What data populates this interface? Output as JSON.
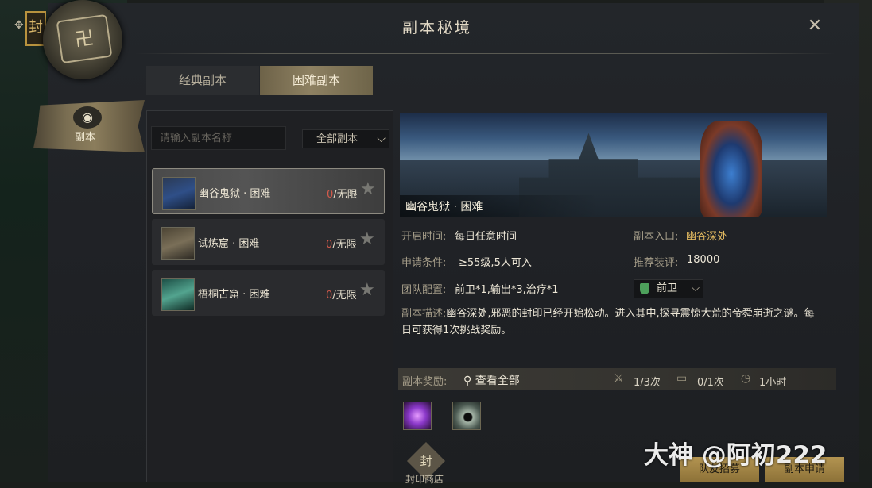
{
  "window": {
    "title": "副本秘境",
    "close_icon": "close-icon"
  },
  "corner_tab": {
    "glyph": "封"
  },
  "sidebar": {
    "label": "副本",
    "glyph": "◉"
  },
  "tabs": [
    {
      "label": "经典副本",
      "active": false
    },
    {
      "label": "困难副本",
      "active": true
    }
  ],
  "search": {
    "placeholder": "请输入副本名称",
    "value": ""
  },
  "filter": {
    "label": "全部副本"
  },
  "dungeons": [
    {
      "name": "幽谷鬼狱 · 困难",
      "count_used": "0",
      "count_limit": "/无限",
      "selected": true
    },
    {
      "name": "试炼窟 · 困难",
      "count_used": "0",
      "count_limit": "/无限",
      "selected": false
    },
    {
      "name": "梧桐古窟 · 困难",
      "count_used": "0",
      "count_limit": "/无限",
      "selected": false
    }
  ],
  "detail": {
    "banner_title": "幽谷鬼狱 · 困难",
    "open_time_label": "开启时间:",
    "open_time_value": "每日任意时间",
    "entrance_label": "副本入口:",
    "entrance_value": "幽谷深处",
    "requirement_label": "申请条件:",
    "requirement_value": "≥55级,5人可入",
    "gear_label": "推荐装评:",
    "gear_value": "18000",
    "team_label": "团队配置:",
    "team_value": "前卫*1,输出*3,治疗*1",
    "role_select": "前卫",
    "desc_label": "副本描述:",
    "desc_value": "幽谷深处,邪恶的封印已经开始松动。进入其中,探寻震惊大荒的帝舜崩逝之谜。每日可获得1次挑战奖励。"
  },
  "rewards": {
    "label": "副本奖励:",
    "view_all": "查看全部",
    "stat1": "1/3次",
    "stat2": "0/1次",
    "stat3": "1小时"
  },
  "seal_shop": {
    "label": "封印商店",
    "glyph": "封"
  },
  "buttons": {
    "recruit": "队友招募",
    "apply": "副本申请"
  },
  "watermark": "大神 @阿初222"
}
